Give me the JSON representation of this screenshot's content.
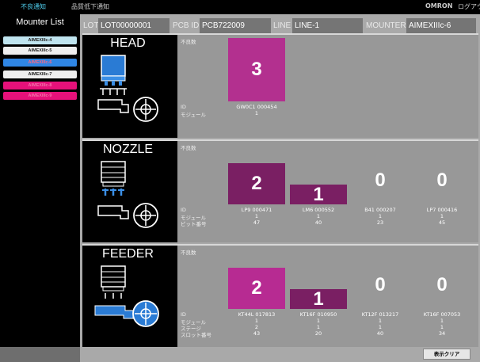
{
  "topbar": {
    "tab1": "不良通知",
    "tab2": "品質低下通知",
    "brand": "OMRON",
    "logout": "ログアウト"
  },
  "sidebar": {
    "title": "Mounter List",
    "items": [
      {
        "label": "AIMEXIIIc-4",
        "bg": "#bfe4ef",
        "color": "#222"
      },
      {
        "label": "AIMEXIIIc-5",
        "bg": "#efefef",
        "color": "#222"
      },
      {
        "label": "AIMEXIIIc-6",
        "bg": "#2f86e4",
        "color": "#f46a86"
      },
      {
        "label": "AIMEXIIIc-7",
        "bg": "#efefef",
        "color": "#222"
      },
      {
        "label": "AIMEXIIIc-8",
        "bg": "#e6117a",
        "color": "#f272aa"
      },
      {
        "label": "AIMEXIIIc-9",
        "bg": "#e6117a",
        "color": "#f272aa"
      }
    ]
  },
  "header": {
    "lot_label": "LOT",
    "lot_value": "LOT00000001",
    "pcb_label": "PCB ID",
    "pcb_value": "PCB722009",
    "line_label": "LINE",
    "line_value": "LINE-1",
    "mounter_label": "MOUNTER",
    "mounter_value": "AIMEXIIIc-6"
  },
  "colors": {
    "bar_head": "#b3308f",
    "bar_nozzle": "#7a1f63",
    "bar_feeder": "#b72b92"
  },
  "panels": {
    "head": {
      "title": "HEAD",
      "caption": "不良数",
      "labels": {
        "id": "ID",
        "module": "モジュール"
      },
      "items": [
        {
          "count": "3",
          "id": "GW0C1 000454",
          "module": "1"
        }
      ]
    },
    "nozzle": {
      "title": "NOZZLE",
      "caption": "不良数",
      "labels": {
        "id": "ID",
        "module": "モジュール",
        "pit": "ピット番号"
      },
      "items": [
        {
          "count": "2",
          "id": "LP9 000471",
          "module": "1",
          "pit": "47"
        },
        {
          "count": "1",
          "id": "LM6 000552",
          "module": "1",
          "pit": "40"
        },
        {
          "count": "0",
          "id": "B41 000207",
          "module": "1",
          "pit": "23"
        },
        {
          "count": "0",
          "id": "LP7 000416",
          "module": "1",
          "pit": "45"
        }
      ]
    },
    "feeder": {
      "title": "FEEDER",
      "caption": "不良数",
      "labels": {
        "id": "ID",
        "module": "モジュール",
        "stage": "ステージ",
        "slot": "スロット番号"
      },
      "items": [
        {
          "count": "2",
          "id": "KT44L 017813",
          "module": "1",
          "stage": "2",
          "slot": "43"
        },
        {
          "count": "1",
          "id": "KT16F 010950",
          "module": "1",
          "stage": "1",
          "slot": "20"
        },
        {
          "count": "0",
          "id": "KT12F 013217",
          "module": "1",
          "stage": "1",
          "slot": "40"
        },
        {
          "count": "0",
          "id": "KT16F 007053",
          "module": "1",
          "stage": "1",
          "slot": "34"
        }
      ]
    }
  },
  "footer": {
    "clear_button": "表示クリア"
  }
}
